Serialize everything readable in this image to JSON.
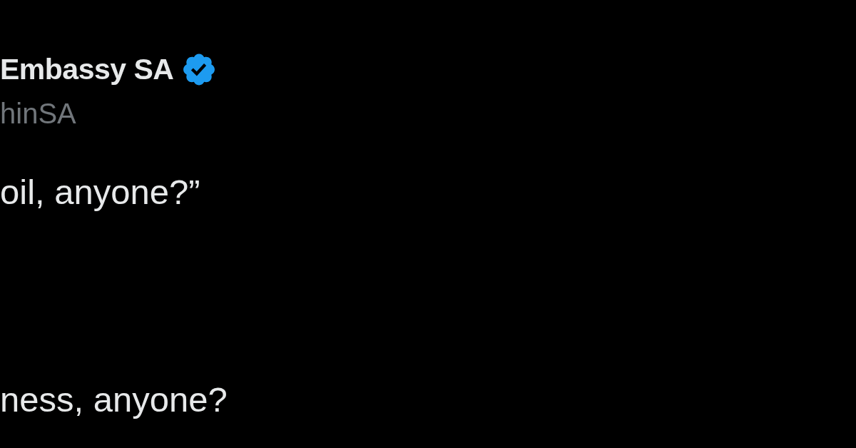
{
  "tweet": {
    "author": {
      "display_name": "Embassy SA",
      "verified": true,
      "handle": "hinSA"
    },
    "paragraphs": [
      "oil, anyone?”",
      "ness, anyone?"
    ]
  }
}
